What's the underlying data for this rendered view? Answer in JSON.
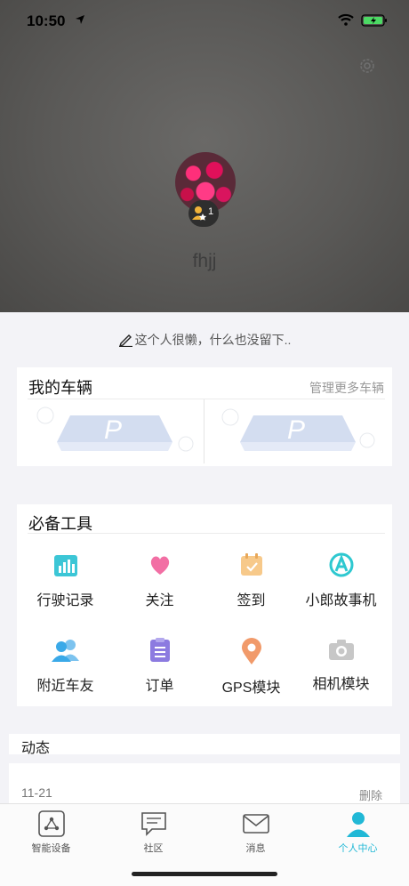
{
  "status_bar": {
    "time": "10:50"
  },
  "profile": {
    "username": "fhjj",
    "level": "1",
    "signature": "这个人很懒，什么也没留下.."
  },
  "vehicles": {
    "title": "我的车辆",
    "manage_link": "管理更多车辆"
  },
  "tools": {
    "title": "必备工具",
    "items": [
      {
        "label": "行驶记录",
        "icon": "chart-icon",
        "color": "#3cc6d6"
      },
      {
        "label": "关注",
        "icon": "heart-icon",
        "color": "#f26fa4"
      },
      {
        "label": "签到",
        "icon": "calendar-icon",
        "color": "#f7c98a"
      },
      {
        "label": "小郎故事机",
        "icon": "story-machine-icon",
        "color": "#2ec8d0"
      },
      {
        "label": "附近车友",
        "icon": "people-icon",
        "color": "#3aa9e8"
      },
      {
        "label": "订单",
        "icon": "clipboard-icon",
        "color": "#8c7be0"
      },
      {
        "label": "GPS模块",
        "icon": "location-pin-icon",
        "color": "#f19a6a"
      },
      {
        "label": "相机模块",
        "icon": "camera-icon",
        "color": "#c7c7c7"
      }
    ]
  },
  "feed": {
    "title": "动态",
    "items": [
      {
        "date": "11-21",
        "delete_label": "删除"
      }
    ]
  },
  "tabbar": {
    "tabs": [
      {
        "label": "智能设备",
        "icon": "device-icon"
      },
      {
        "label": "社区",
        "icon": "chat-icon"
      },
      {
        "label": "消息",
        "icon": "mail-icon"
      },
      {
        "label": "个人中心",
        "icon": "person-icon",
        "active": true
      }
    ]
  },
  "colors": {
    "accent": "#21b8d6"
  }
}
